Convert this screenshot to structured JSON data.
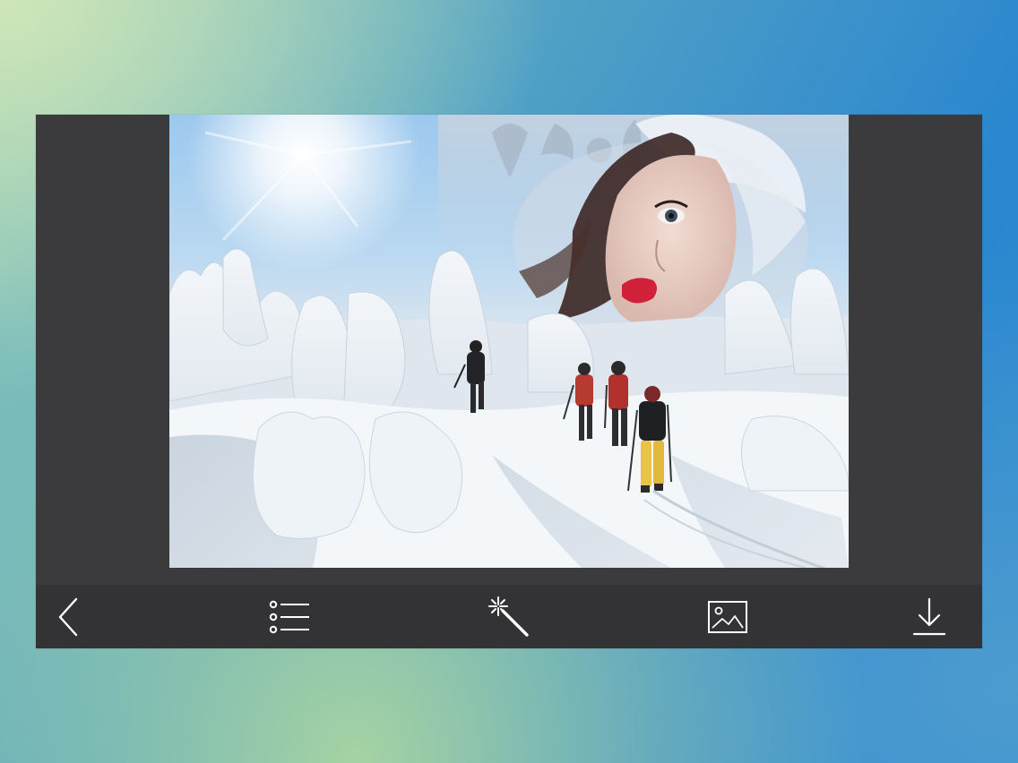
{
  "photo": {
    "description_icon": "photo-collage-icon"
  },
  "toolbar": {
    "items": [
      {
        "name": "back",
        "icon": "chevron-left-icon"
      },
      {
        "name": "frames",
        "icon": "list-icon"
      },
      {
        "name": "effects",
        "icon": "magic-wand-icon"
      },
      {
        "name": "gallery",
        "icon": "image-icon"
      },
      {
        "name": "save",
        "icon": "download-icon"
      }
    ]
  },
  "colors": {
    "panel": "#3b3a3c",
    "toolbar": "#333234",
    "icon": "#ffffff"
  }
}
